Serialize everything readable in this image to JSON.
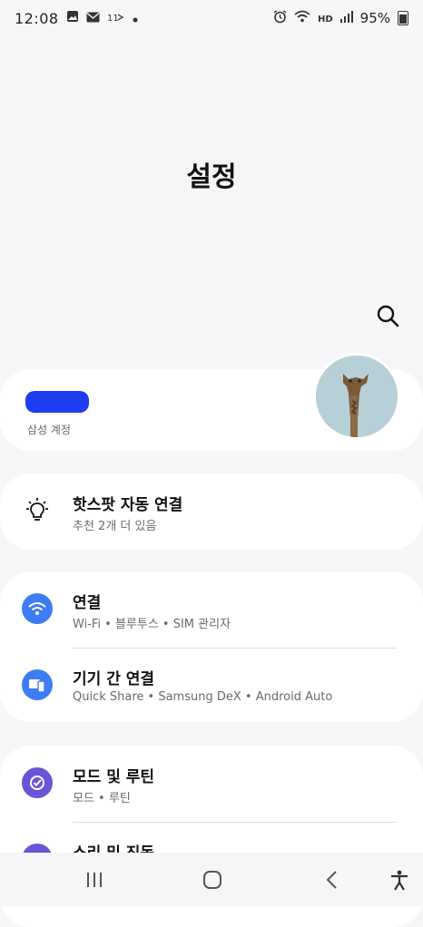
{
  "status_bar": {
    "time": "12:08",
    "left_icons": [
      "gallery-icon",
      "mail-icon",
      "bluetooth-headset-icon",
      "dot-icon"
    ],
    "right_icons": [
      "alarm-icon",
      "wifi-icon",
      "hd-voice-icon",
      "signal-icon"
    ],
    "hd_label": "HD",
    "battery_percent": "95%"
  },
  "page": {
    "title": "설정"
  },
  "account": {
    "label": "삼성 계정"
  },
  "hotspot": {
    "title": "핫스팟 자동 연결",
    "subtitle": "추천 2개 더 있음"
  },
  "connections": {
    "title": "연결",
    "subtitle": "Wi-Fi • 블루투스 • SIM 관리자"
  },
  "device_connection": {
    "title": "기기 간 연결",
    "subtitle": "Quick Share • Samsung DeX • Android Auto"
  },
  "modes": {
    "title": "모드 및 루틴",
    "subtitle": "모드 • 루틴"
  },
  "sound": {
    "title": "소리 및 진동"
  },
  "colors": {
    "wifi_icon_bg": "#3d7cf3",
    "device_icon_bg": "#3d7cf3",
    "modes_icon_bg": "#6a55d6",
    "sound_icon_bg": "#6a55d6",
    "account_redaction": "#1e3cf0"
  }
}
